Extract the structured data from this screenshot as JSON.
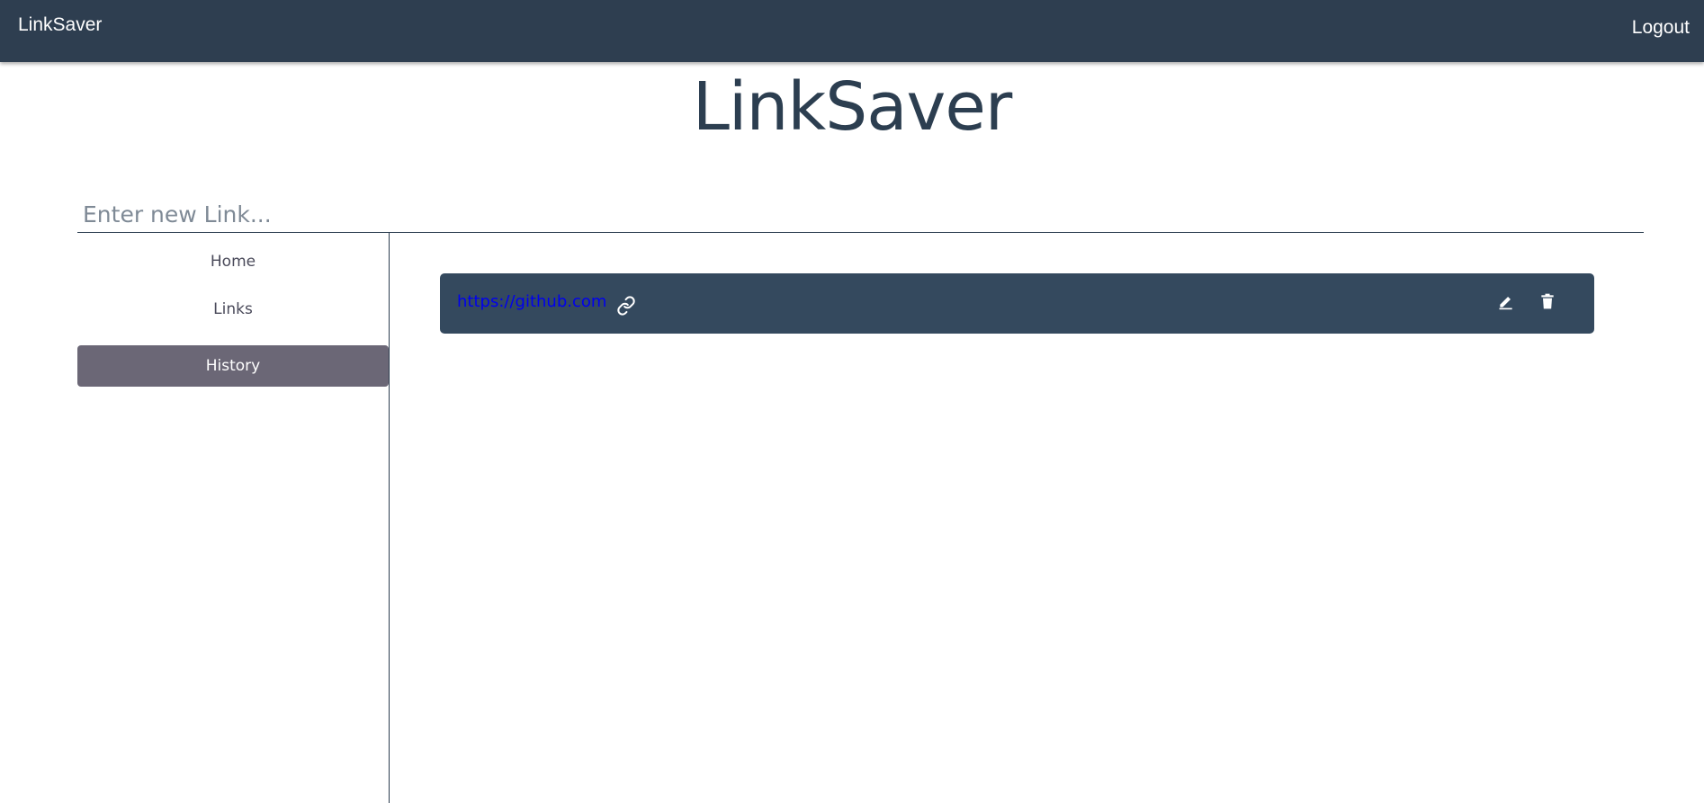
{
  "navbar": {
    "brand": "LinkSaver",
    "logout_label": "Logout",
    "background": "#2e3e50"
  },
  "header": {
    "title": "LinkSaver"
  },
  "new_link": {
    "value": "",
    "placeholder": "Enter new Link..."
  },
  "sidebar": {
    "items": [
      {
        "label": "Home",
        "active": false
      },
      {
        "label": "Links",
        "active": false
      },
      {
        "label": "History",
        "active": true
      }
    ],
    "active_color": "#6b6776"
  },
  "links": [
    {
      "url": "https://github.com",
      "icons": [
        "link-icon",
        "edit-icon",
        "delete-icon"
      ]
    }
  ],
  "colors": {
    "primary": "#2c3e50",
    "card": "#34495e",
    "link_text": "#0000ee"
  }
}
